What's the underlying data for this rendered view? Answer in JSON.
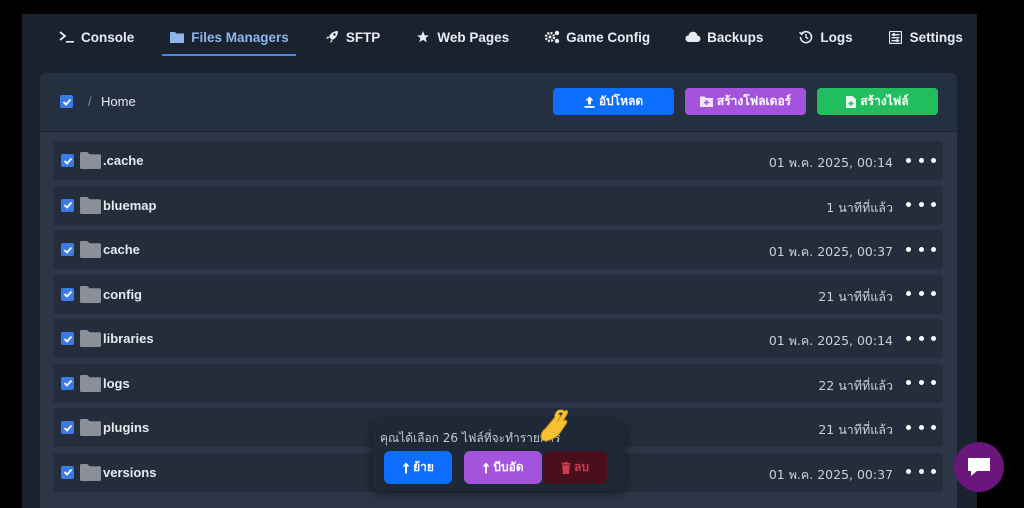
{
  "tabs": [
    {
      "label": "Console",
      "icon": "terminal-icon"
    },
    {
      "label": "Files Managers",
      "icon": "folder-icon",
      "active": true
    },
    {
      "label": "SFTP",
      "icon": "rocket-icon"
    },
    {
      "label": "Web Pages",
      "icon": "star-icon"
    },
    {
      "label": "Game Config",
      "icon": "gears-icon"
    },
    {
      "label": "Backups",
      "icon": "cloud-icon"
    },
    {
      "label": "Logs",
      "icon": "history-icon"
    },
    {
      "label": "Settings",
      "icon": "sliders-icon"
    }
  ],
  "breadcrumb": {
    "separator": "/",
    "home": "Home"
  },
  "actions": {
    "upload": "อัปโหลด",
    "new_folder": "สร้างโฟลเดอร์",
    "new_file": "สร้างไฟล์"
  },
  "files": [
    {
      "name": ".cache",
      "date": "01 พ.ค. 2025, 00:14"
    },
    {
      "name": "bluemap",
      "date": "1 นาทีที่แล้ว"
    },
    {
      "name": "cache",
      "date": "01 พ.ค. 2025, 00:37"
    },
    {
      "name": "config",
      "date": "21 นาทีที่แล้ว"
    },
    {
      "name": "libraries",
      "date": "01 พ.ค. 2025, 00:14"
    },
    {
      "name": "logs",
      "date": "22 นาทีที่แล้ว"
    },
    {
      "name": "plugins",
      "date": "21 นาทีที่แล้ว"
    },
    {
      "name": "versions",
      "date": "01 พ.ค. 2025, 00:37"
    }
  ],
  "selection": {
    "message": "คุณได้เลือก 26 ไฟล์ที่จะทำรายการ",
    "move": "ย้าย",
    "zip": "บีบอัด",
    "delete": "ลบ"
  },
  "colors": {
    "accent": "#4a8ae2",
    "upload": "#0d6efd",
    "folder": "#a453dd",
    "file": "#22bd5f",
    "delete_bg": "#4a0f1c",
    "delete_fg": "#d23b4f",
    "chat": "#6a167a"
  }
}
